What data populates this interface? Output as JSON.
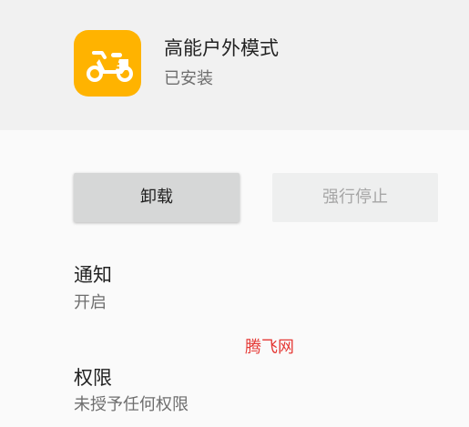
{
  "app": {
    "name": "高能户外模式",
    "status": "已安装",
    "icon": "scooter-icon",
    "icon_color": "#ffb300"
  },
  "actions": {
    "uninstall_label": "卸载",
    "force_stop_label": "强行停止"
  },
  "notifications": {
    "title": "通知",
    "value": "开启"
  },
  "watermark": "腾飞网",
  "permissions": {
    "title": "权限",
    "value": "未授予任何权限"
  }
}
